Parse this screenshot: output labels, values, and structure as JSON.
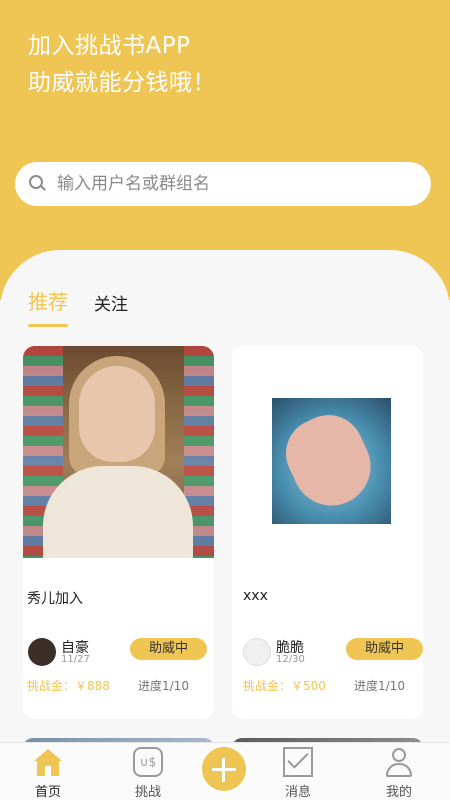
{
  "header": {
    "line1": "加入挑战书APP",
    "line2": "助威就能分钱哦！"
  },
  "search": {
    "placeholder": "输入用户名或群组名"
  },
  "tabs": [
    {
      "label": "推荐",
      "active": true
    },
    {
      "label": "关注",
      "active": false
    }
  ],
  "cards": [
    {
      "title": "秀儿加入",
      "user": "自豪",
      "date": "11/27",
      "button": "助威中",
      "money": "挑战金：￥888",
      "progress": "进度1/10"
    },
    {
      "title": "xxx",
      "user": "脆脆",
      "date": "12/30",
      "button": "助威中",
      "money": "挑战金：￥500",
      "progress": "进度1/10"
    }
  ],
  "nav": {
    "home": "首页",
    "challenge": "挑战",
    "messages": "消息",
    "me": "我的"
  },
  "colors": {
    "accent": "#efc553",
    "background": "#f7f7f7"
  }
}
